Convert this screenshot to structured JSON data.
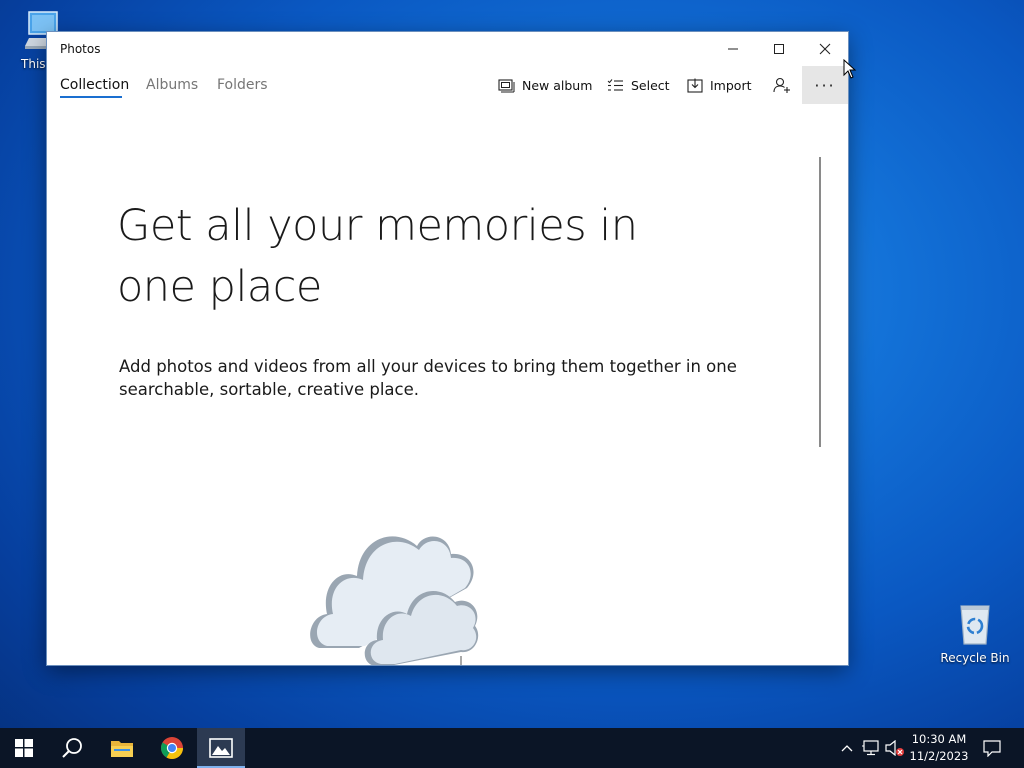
{
  "desktop": {
    "icons": [
      {
        "label": "This PC"
      },
      {
        "label": "Recycle Bin"
      }
    ]
  },
  "window": {
    "title": "Photos",
    "controls": {
      "minimize": "minimize-icon",
      "maximize": "maximize-icon",
      "close": "close-icon"
    },
    "tabs": [
      {
        "label": "Collection",
        "active": true
      },
      {
        "label": "Albums",
        "active": false
      },
      {
        "label": "Folders",
        "active": false
      }
    ],
    "commands": [
      {
        "label": "New album",
        "icon": "new-album-icon"
      },
      {
        "label": "Select",
        "icon": "select-icon"
      },
      {
        "label": "Import",
        "icon": "import-icon"
      }
    ],
    "more_label": "···",
    "content": {
      "headline": "Get all your memories in one place",
      "description": "Add photos and videos from all your devices to bring them together in one searchable, sortable, creative place."
    }
  },
  "taskbar": {
    "apps": [
      {
        "name": "start",
        "icon": "windows-logo-icon"
      },
      {
        "name": "search",
        "icon": "search-icon"
      },
      {
        "name": "file-explorer",
        "icon": "folder-icon"
      },
      {
        "name": "chrome",
        "icon": "chrome-icon"
      },
      {
        "name": "photos",
        "icon": "photos-icon",
        "active": true
      }
    ],
    "clock": {
      "time": "10:30 AM",
      "date": "11/2/2023"
    }
  },
  "colors": {
    "accent": "#1a6fd0",
    "taskbar": "#0b1526",
    "desktop": "#0a58c2"
  }
}
